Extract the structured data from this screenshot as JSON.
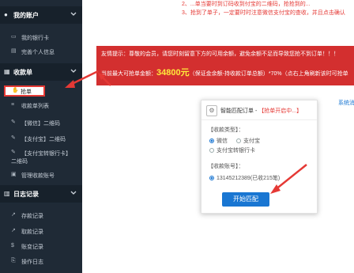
{
  "top_notices": [
    "2、...单当要时到订码收到付宝的二维码，抢抢到的...",
    "3、抢到了单子，一定要时时注意微信支付宝的查收，并且点击确认"
  ],
  "sidebar": {
    "account": {
      "title": "我的账户",
      "items": [
        {
          "label": "我的银行卡",
          "icon": "bank-card-icon"
        },
        {
          "label": "完善个人信息",
          "icon": "user-icon"
        }
      ]
    },
    "receipt": {
      "title": "收款单",
      "items": [
        {
          "label": "抢单",
          "icon": "hand-icon"
        },
        {
          "label": "收款单列表",
          "icon": "list-icon"
        },
        {
          "label": "【微信】二维码",
          "icon": "edit-icon"
        },
        {
          "label": "【支付宝】二维码",
          "icon": "edit-icon"
        },
        {
          "label": "【支付宝转银行卡】",
          "label2": "二维码",
          "icon": "edit-icon"
        },
        {
          "label": "管理收款账号",
          "icon": "manage-icon"
        }
      ]
    },
    "logs": {
      "title": "日志记录",
      "items": [
        {
          "label": "存款记录",
          "icon": "chart-icon"
        },
        {
          "label": "取款记录",
          "icon": "chart-icon"
        },
        {
          "label": "账变记录",
          "icon": "money-icon"
        },
        {
          "label": "操作日志",
          "icon": "log-icon"
        }
      ]
    }
  },
  "alert": {
    "line1": "友情提示：尊敬的会员，请您时刻留意下方的可用余额，避免余额不足而导致您抢不到订单！！！",
    "line2_prefix": "当前最大可抢单金额：",
    "amount": "34800元",
    "line2_suffix": "（保证金余额-持收款订单总额）*70%（点右上角刷新该时可抢单"
  },
  "card": {
    "title": "智能匹配订单 - ",
    "status": "【抢单开启中...】",
    "type_label": "【收款类型】：",
    "type_options": [
      {
        "label": "微信",
        "checked": true
      },
      {
        "label": "支付宝",
        "checked": false
      },
      {
        "label": "支付宝转银行卡",
        "checked": false
      }
    ],
    "account_label": "【收款账号】：",
    "account_value": "13145212389(已收215笔)",
    "start_button": "开始匹配"
  },
  "sys_link": "系统消"
}
